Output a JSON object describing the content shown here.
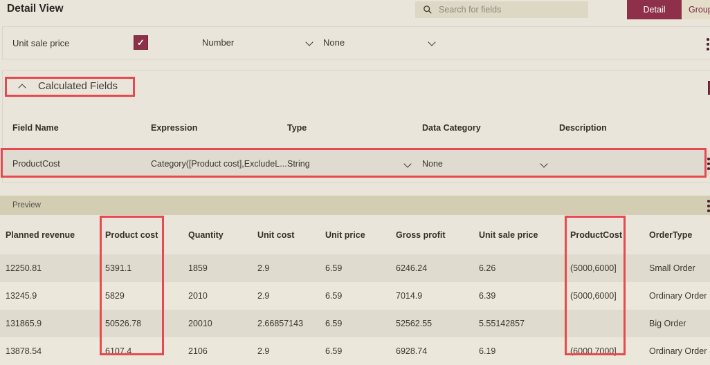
{
  "window": {
    "title": "Detail View"
  },
  "toolbar": {
    "search": {
      "placeholder": "Search for fields",
      "icon": "search-icon"
    },
    "view_toggle": [
      {
        "label": "Detail",
        "active": true
      },
      {
        "label": "Group",
        "active": false
      }
    ]
  },
  "icons": {
    "checkmark": "✓"
  },
  "selected_field_row": {
    "field_name": "Unit sale price",
    "visible_checked": true,
    "type_value": "Number",
    "data_category_value": "None"
  },
  "calculated_fields": {
    "title": "Calculated Fields",
    "headers": {
      "field_name": "Field Name",
      "expression": "Expression",
      "type": "Type",
      "data_category": "Data Category",
      "description": "Description"
    },
    "row": {
      "field_name": "ProductCost",
      "expression": "Category([Product cost],ExcludeL...",
      "type_value": "String",
      "data_category_value": "None",
      "description": ""
    }
  },
  "preview": {
    "title": "Preview",
    "columns": [
      "Planned revenue",
      "Product cost",
      "Quantity",
      "Unit cost",
      "Unit price",
      "Gross profit",
      "Unit sale price",
      "ProductCost",
      "OrderType"
    ],
    "rows": [
      [
        "12250.81",
        "5391.1",
        "1859",
        "2.9",
        "6.59",
        "6246.24",
        "6.26",
        "(5000,6000]",
        "Small Order"
      ],
      [
        "13245.9",
        "5829",
        "2010",
        "2.9",
        "6.59",
        "7014.9",
        "6.39",
        "(5000,6000]",
        "Ordinary Order"
      ],
      [
        "131865.9",
        "50526.78",
        "20010",
        "2.66857143",
        "6.59",
        "52562.55",
        "5.55142857",
        "",
        "Big Order"
      ],
      [
        "13878.54",
        "6107.4",
        "2106",
        "2.9",
        "6.59",
        "6928.74",
        "6.19",
        "(6000,7000]",
        "Ordinary Order"
      ]
    ]
  },
  "colors": {
    "page_background": "#e9e5da",
    "accent_maroon": "#8e3049",
    "annotation_red": "#e8494e",
    "preview_bar": "#d2cdb3",
    "row_stripe_dark": "#dfdbce",
    "row_stripe_light": "#ebe7db"
  }
}
